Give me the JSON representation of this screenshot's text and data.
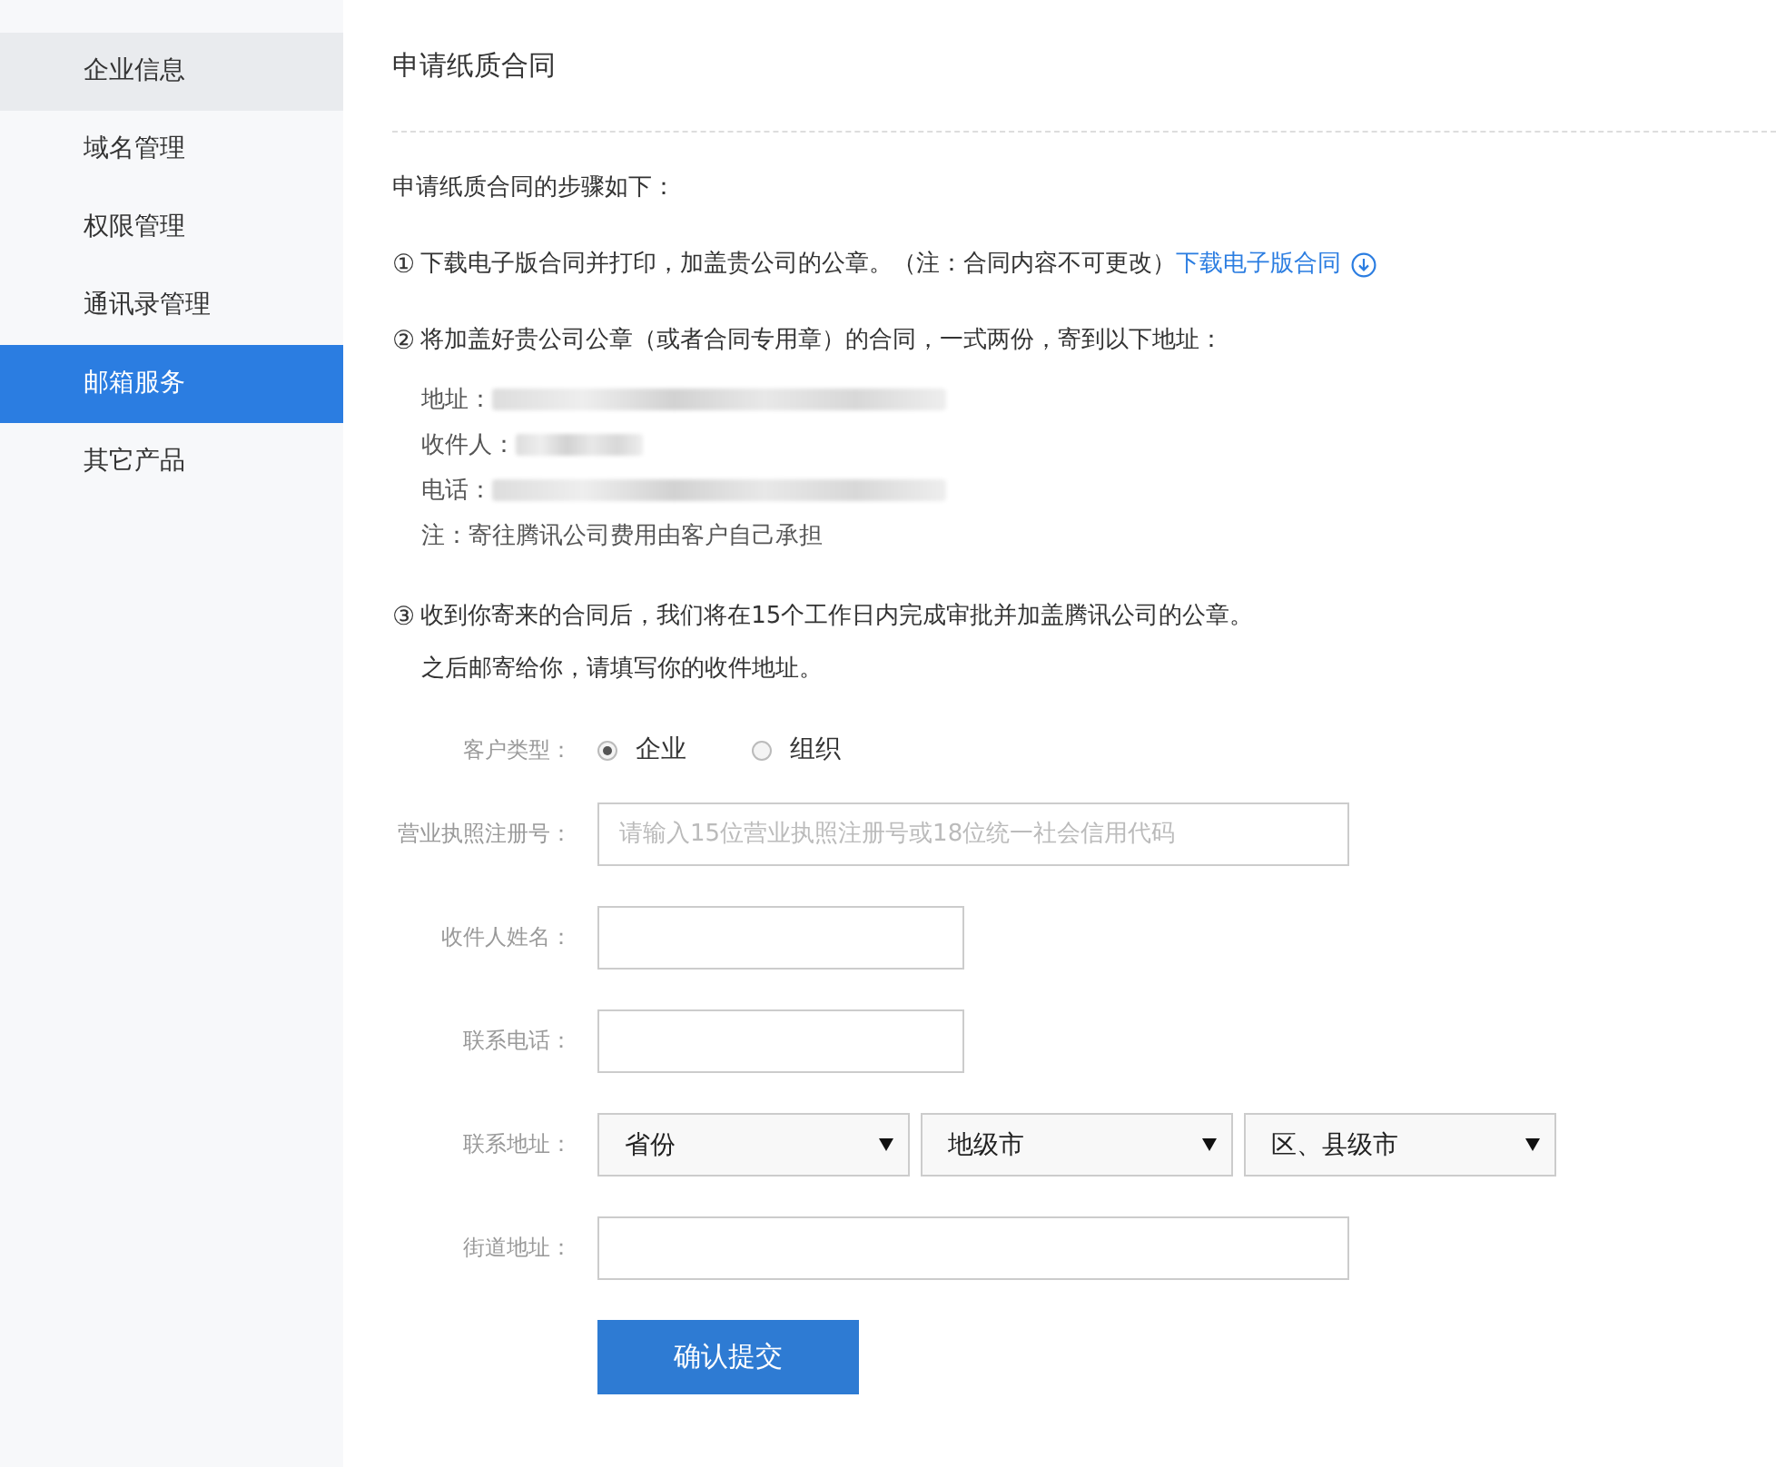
{
  "sidebar": {
    "items": [
      {
        "label": "企业信息",
        "selected": false,
        "hovered": true
      },
      {
        "label": "域名管理",
        "selected": false,
        "hovered": false
      },
      {
        "label": "权限管理",
        "selected": false,
        "hovered": false
      },
      {
        "label": "通讯录管理",
        "selected": false,
        "hovered": false
      },
      {
        "label": "邮箱服务",
        "selected": true,
        "hovered": false
      },
      {
        "label": "其它产品",
        "selected": false,
        "hovered": false
      }
    ]
  },
  "page": {
    "title": "申请纸质合同",
    "intro": "申请纸质合同的步骤如下：",
    "steps": [
      {
        "number": "①",
        "text": "下载电子版合同并打印，加盖贵公司的公章。（注：合同内容不可更改）",
        "link": "下载电子版合同"
      },
      {
        "number": "②",
        "text": "将加盖好贵公司公章（或者合同专用章）的合同，一式两份，寄到以下地址：",
        "details": [
          {
            "label": "地址：",
            "redacted": true
          },
          {
            "label": "收件人：",
            "redacted": true
          },
          {
            "label": "电话：",
            "redacted": true
          },
          {
            "label": "注：寄往腾讯公司费用由客户自己承担",
            "redacted": false
          }
        ]
      },
      {
        "number": "③",
        "text": "收到你寄来的合同后，我们将在15个工作日内完成审批并加盖腾讯公司的公章。",
        "continuation": "之后邮寄给你，请填写你的收件地址。"
      }
    ]
  },
  "form": {
    "fields": [
      {
        "kind": "radio",
        "label": "客户类型：",
        "options": [
          {
            "label": "企业",
            "selected": true
          },
          {
            "label": "组织",
            "selected": false
          }
        ]
      },
      {
        "kind": "text",
        "label": "营业执照注册号：",
        "placeholder": "请输入15位营业执照注册号或18位统一社会信用代码",
        "wide": true
      },
      {
        "kind": "text",
        "label": "收件人姓名：",
        "wide": false
      },
      {
        "kind": "text",
        "label": "联系电话：",
        "wide": false
      },
      {
        "kind": "selects",
        "label": "联系地址：",
        "selects": [
          {
            "value": "省份"
          },
          {
            "value": "地级市"
          },
          {
            "value": "区、县级市"
          }
        ]
      },
      {
        "kind": "text",
        "label": "街道地址：",
        "wide": true
      }
    ],
    "submit": "确认提交"
  }
}
